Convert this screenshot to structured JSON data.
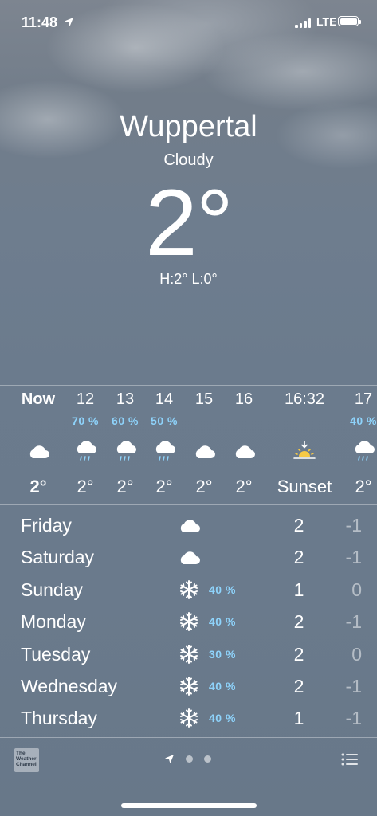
{
  "status_bar": {
    "time": "11:48",
    "network": "LTE"
  },
  "location": {
    "city": "Wuppertal",
    "condition": "Cloudy",
    "temperature": "2°",
    "hi_lo": "H:2°  L:0°"
  },
  "hourly": [
    {
      "label": "Now",
      "pop": "",
      "icon": "cloud-icon",
      "temp": "2°",
      "bold": true
    },
    {
      "label": "12",
      "pop": "70 %",
      "icon": "cloud-rain-icon",
      "temp": "2°"
    },
    {
      "label": "13",
      "pop": "60 %",
      "icon": "cloud-rain-icon",
      "temp": "2°"
    },
    {
      "label": "14",
      "pop": "50 %",
      "icon": "cloud-rain-icon",
      "temp": "2°"
    },
    {
      "label": "15",
      "pop": "",
      "icon": "cloud-icon",
      "temp": "2°"
    },
    {
      "label": "16",
      "pop": "",
      "icon": "cloud-icon",
      "temp": "2°"
    },
    {
      "label": "16:32",
      "pop": "",
      "icon": "sunset-icon",
      "temp": "Sunset"
    },
    {
      "label": "17",
      "pop": "40 %",
      "icon": "cloud-rain-icon",
      "temp": "2°"
    }
  ],
  "daily": [
    {
      "day": "Friday",
      "icon": "cloud-icon",
      "pop": "",
      "high": "2",
      "low": "-1"
    },
    {
      "day": "Saturday",
      "icon": "cloud-icon",
      "pop": "",
      "high": "2",
      "low": "-1"
    },
    {
      "day": "Sunday",
      "icon": "snowflake-icon",
      "pop": "40 %",
      "high": "1",
      "low": "0"
    },
    {
      "day": "Monday",
      "icon": "snowflake-icon",
      "pop": "40 %",
      "high": "2",
      "low": "-1"
    },
    {
      "day": "Tuesday",
      "icon": "snowflake-icon",
      "pop": "30 %",
      "high": "2",
      "low": "0"
    },
    {
      "day": "Wednesday",
      "icon": "snowflake-icon",
      "pop": "40 %",
      "high": "2",
      "low": "-1"
    },
    {
      "day": "Thursday",
      "icon": "snowflake-icon",
      "pop": "40 %",
      "high": "1",
      "low": "-1"
    }
  ],
  "footer": {
    "logo_text": "The Weather Channel",
    "page_dots": 2
  },
  "colors": {
    "precip": "#8ed3fb"
  }
}
